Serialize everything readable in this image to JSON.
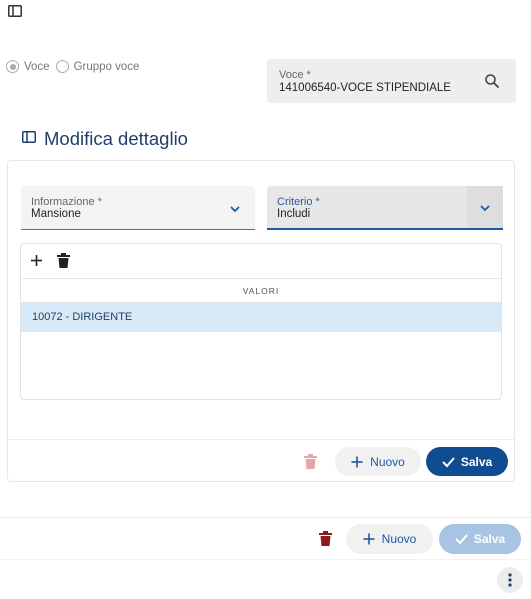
{
  "top": {
    "panel_toggle_icon": "panel-toggle-icon"
  },
  "selector": {
    "options": [
      {
        "label": "Voce",
        "checked": true
      },
      {
        "label": "Gruppo voce",
        "checked": false
      }
    ]
  },
  "voce": {
    "label": "Voce *",
    "value": "141006540-VOCE STIPENDIALE",
    "icon": "search-icon"
  },
  "section": {
    "title": "Modifica dettaglio",
    "icon": "panel-toggle-icon"
  },
  "detail": {
    "informazione": {
      "label": "Informazione *",
      "value": "Mansione"
    },
    "criterio": {
      "label": "Criterio *",
      "value": "Includi"
    },
    "grid": {
      "header": "VALORI",
      "rows": [
        "10072 - DIRIGENTE"
      ]
    },
    "actions": {
      "new_label": "Nuovo",
      "save_label": "Salva"
    }
  },
  "footer_actions": {
    "new_label": "Nuovo",
    "save_label": "Salva"
  },
  "colors": {
    "accent": "#0f4c92",
    "title": "#1f3f6b",
    "selected_row": "#d8e9f7",
    "delete_active": "#8b1a1a",
    "delete_disabled": "#e3a7a7",
    "save_disabled": "#a8c3e4"
  }
}
